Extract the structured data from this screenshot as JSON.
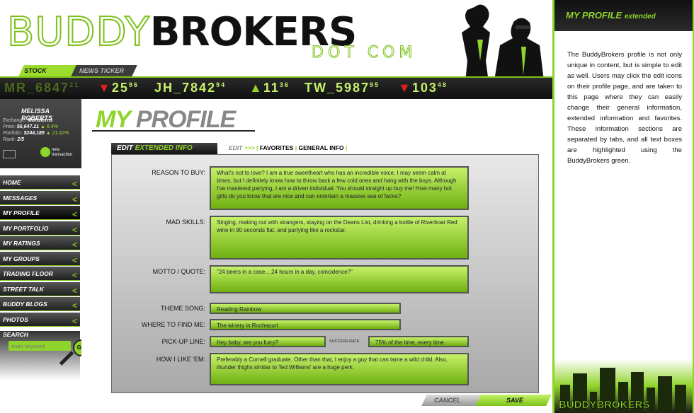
{
  "header": {
    "logo_buddy": "BUDDY",
    "logo_brokers": "BROKERS",
    "logo_dotcom": "DOT COM"
  },
  "ticker": {
    "tabs": [
      "STOCK TICKER",
      "NEWS TICKER"
    ],
    "items": [
      {
        "sym": "MR_6847",
        "dec": "21",
        "dim": true
      },
      {
        "sym": "25",
        "dec": "96",
        "dir": "down"
      },
      {
        "sym": "JH_7842",
        "dec": "94"
      },
      {
        "sym": "11",
        "dec": "36",
        "dir": "up"
      },
      {
        "sym": "TW_5987",
        "dec": "95"
      },
      {
        "sym": "103",
        "dec": "48",
        "dir": "down"
      }
    ]
  },
  "user": {
    "name": "MELISSA ROBERTS",
    "exchange_label": "Exchange:",
    "exchange": "Monsterns",
    "price_label": "Price:",
    "price": "$6,647.21",
    "price_change": "6.4%",
    "portfolio_label": "Portfolio:",
    "portfolio": "$244,185",
    "portfolio_change": "21.62%",
    "rank_label": "Rank:",
    "rank": "2/5",
    "new_transaction": "new transaction"
  },
  "nav": [
    "HOME",
    "MESSAGES",
    "MY PROFILE",
    "MY PORTFOLIO",
    "MY RATINGS",
    "MY GROUPS",
    "TRADING FLOOR",
    "STREET TALK",
    "BUDDY BLOGS",
    "PHOTOS"
  ],
  "search": {
    "label": "SEARCH",
    "placeholder": "enter keyword",
    "go": "GO"
  },
  "page": {
    "title_my": "MY",
    "title_profile": "PROFILE",
    "panel_tab_a": "EDIT",
    "panel_tab_b": "EXTENDED INFO",
    "subtab_edit": "EDIT",
    "subtab_arrows": ">>>",
    "subtab_favorites": "FAVORITES",
    "subtab_general": "GENERAL INFO"
  },
  "fields": {
    "reason_label": "REASON TO BUY:",
    "reason": "What's not to love? I am a true sweetheart who has an incredible voice. I may seem calm at times, but I definitely know how to throw back a few cold ones and hang with the boys. Although I've mastered partying, I am a driven individual. You should straight up buy me! How many hot girls do you know that are nice and can entertain a massive sea of faces?",
    "skills_label": "MAD SKILLS:",
    "skills": "Singing, making out with strangers, staying on the Deans List, drinking a bottle of Riverboat Red wine in 90 seconds flat, and partying like a rockstar.",
    "motto_label": "MOTTO / QUOTE:",
    "motto": "\"24 beers in a case....24 hours in a day, coincidence?\"",
    "theme_label": "THEME SONG:",
    "theme": "Reading Rainbow",
    "where_label": "WHERE TO FIND ME:",
    "where": "The winery in Rochepurt",
    "pickup_label": "PICK-UP LINE:",
    "pickup": "Hey baby, are you furry?",
    "success_label": "SUCCESS RATE:",
    "success": "75% of the time, every time.",
    "like_label": "HOW I LIKE 'EM:",
    "like": "Preferably a Cornell graduate. Other than that, I enjoy a guy that can tame a wild child. Also, thunder thighs similar to Ted Williams' are a huge perk."
  },
  "actions": {
    "cancel": "CANCEL",
    "save": "SAVE"
  },
  "right": {
    "title": "MY PROFILE",
    "title_suffix": "extended",
    "text": "The BuddyBrokers profile is not only unique in content, but is simple to edit as well. Users may click the edit icons on their profile page, and are taken to this page where they can easily change their general information, extended information and favorites. These information sections are separated by tabs, and all text boxes are highlighted using the BuddyBrokers green.",
    "footer_logo": "BUDDYBROKERS"
  },
  "colors": {
    "accent": "#8fd42a",
    "dark": "#111111"
  }
}
